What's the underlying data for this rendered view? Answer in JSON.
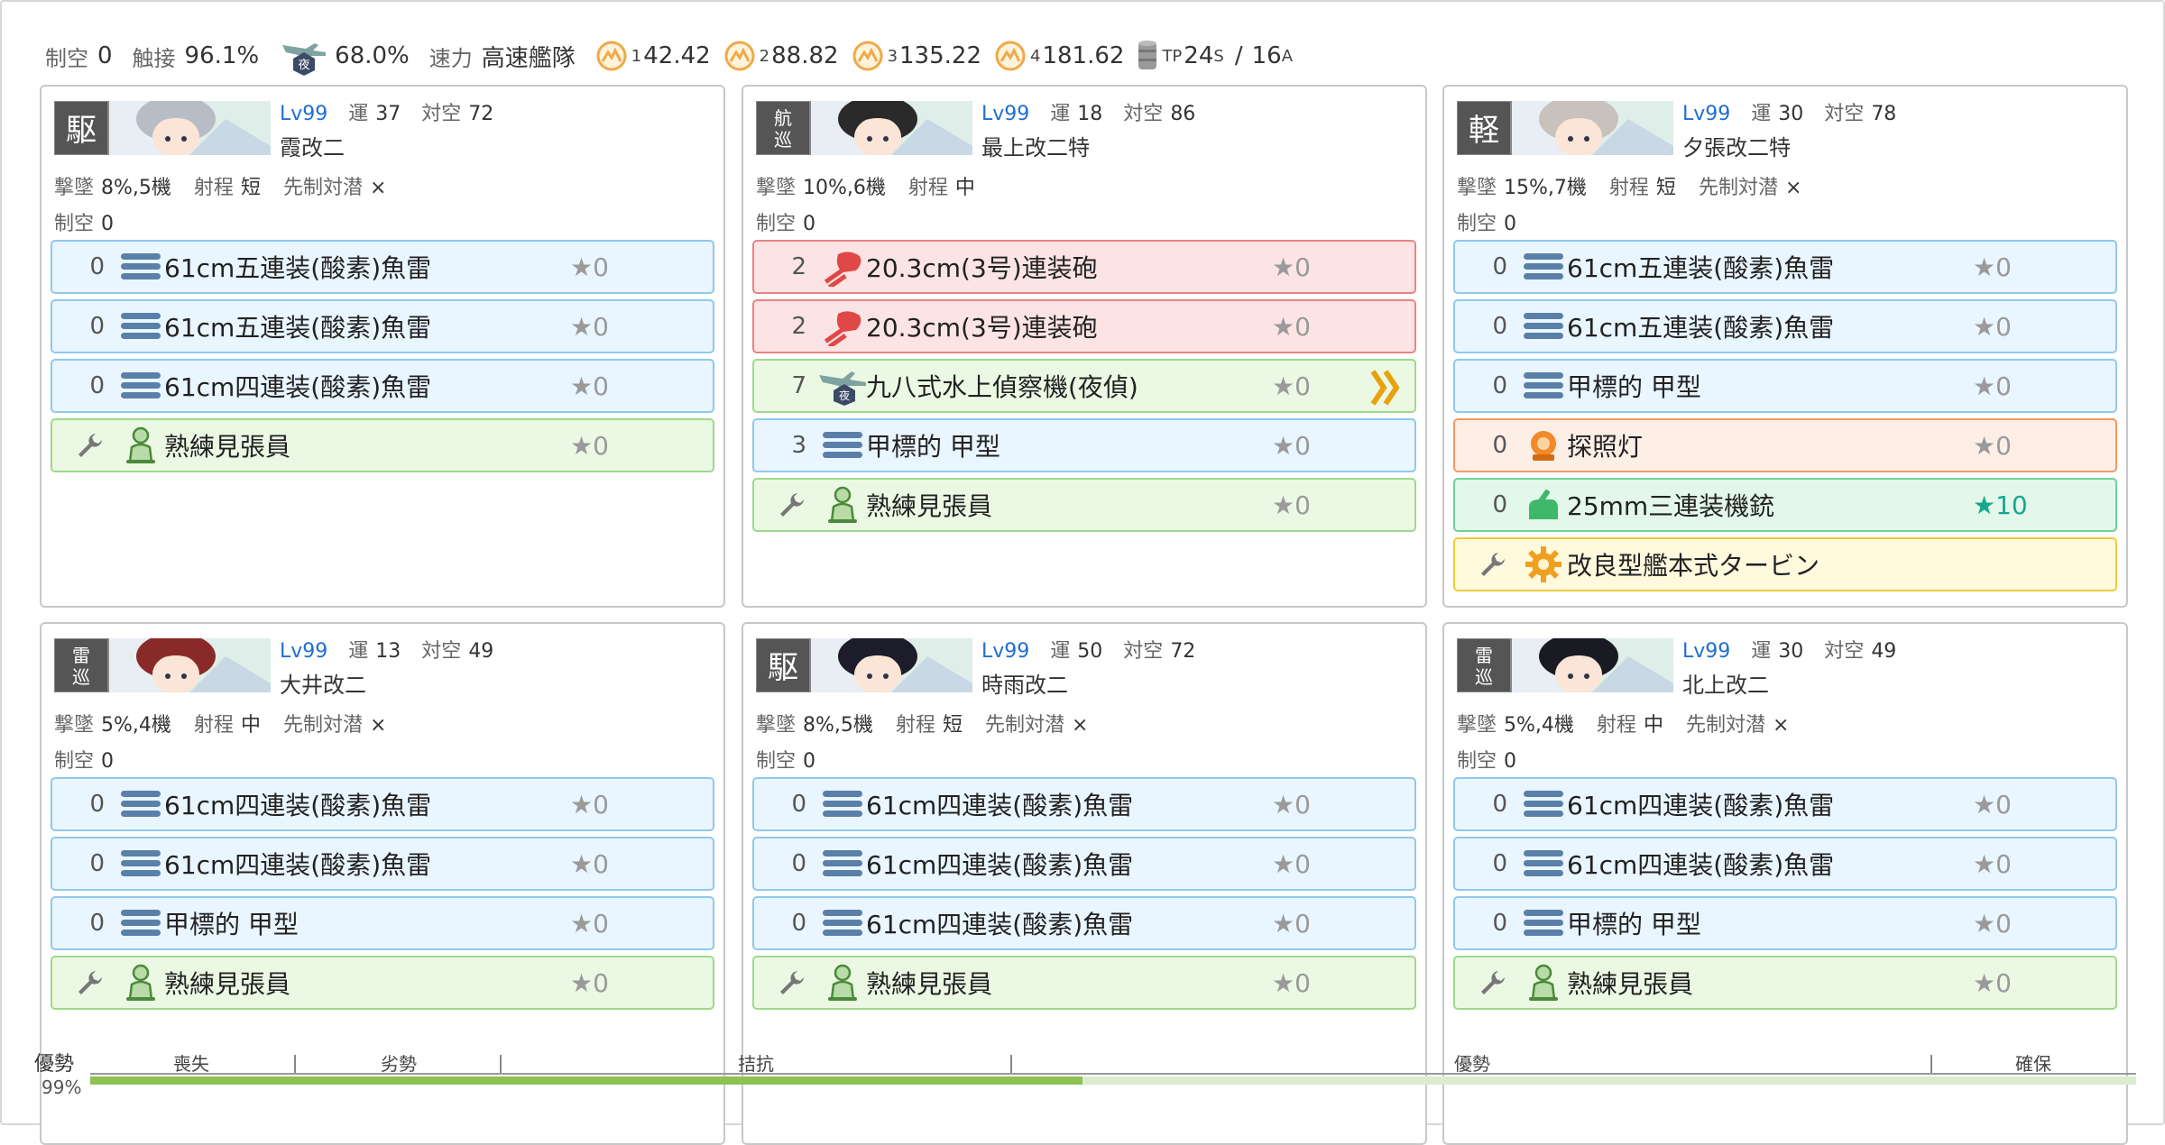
{
  "fleet": {
    "air_label": "制空",
    "air_value": "0",
    "contact_label": "触接",
    "contact_value": "96.1%",
    "night_contact_value": "68.0%",
    "speed_label": "速力",
    "speed_value": "高速艦隊",
    "los": [
      {
        "sub": "1",
        "value": "42.42"
      },
      {
        "sub": "2",
        "value": "88.82"
      },
      {
        "sub": "3",
        "value": "135.22"
      },
      {
        "sub": "4",
        "value": "181.62"
      }
    ],
    "tp_label": "TP",
    "tp_s": "24",
    "tp_s_sub": "S",
    "tp_sep": "/",
    "tp_a": "16",
    "tp_a_sub": "A"
  },
  "labels": {
    "luck": "運",
    "aa": "対空",
    "shootdown": "撃墜",
    "range": "射程",
    "asw": "先制対潜",
    "air": "制空"
  },
  "ships": [
    {
      "lv": "Lv99",
      "luck": "37",
      "aa": "72",
      "name": "霞改二",
      "type_kanji": "駆",
      "shootdown": "8%,5機",
      "range": "短",
      "asw": "×",
      "air": "0",
      "slots": [
        {
          "count": "0",
          "icon": "torpedo-icon",
          "name": "61cm五連装(酸素)魚雷",
          "star": "★0",
          "tone": "blue"
        },
        {
          "count": "0",
          "icon": "torpedo-icon",
          "name": "61cm五連装(酸素)魚雷",
          "star": "★0",
          "tone": "blue"
        },
        {
          "count": "0",
          "icon": "torpedo-icon",
          "name": "61cm四連装(酸素)魚雷",
          "star": "★0",
          "tone": "blue"
        },
        {
          "count": "",
          "icon": "lookout-icon",
          "name": "熟練見張員",
          "star": "★0",
          "tone": "green",
          "ex": true
        }
      ]
    },
    {
      "lv": "Lv99",
      "luck": "18",
      "aa": "86",
      "name": "最上改二特",
      "type_kanji": "航巡",
      "shootdown": "10%,6機",
      "range": "中",
      "asw": "",
      "air": "0",
      "slots": [
        {
          "count": "2",
          "icon": "main-gun-icon",
          "name": "20.3cm(3号)連装砲",
          "star": "★0",
          "tone": "red"
        },
        {
          "count": "2",
          "icon": "main-gun-icon",
          "name": "20.3cm(3号)連装砲",
          "star": "★0",
          "tone": "red"
        },
        {
          "count": "7",
          "icon": "night-seaplane-icon",
          "name": "九八式水上偵察機(夜偵)",
          "star": "★0",
          "tone": "green",
          "prof": true
        },
        {
          "count": "3",
          "icon": "torpedo-icon",
          "name": "甲標的 甲型",
          "star": "★0",
          "tone": "blue"
        },
        {
          "count": "",
          "icon": "lookout-icon",
          "name": "熟練見張員",
          "star": "★0",
          "tone": "green",
          "ex": true
        }
      ]
    },
    {
      "lv": "Lv99",
      "luck": "30",
      "aa": "78",
      "name": "夕張改二特",
      "type_kanji": "軽",
      "shootdown": "15%,7機",
      "range": "短",
      "asw": "×",
      "air": "0",
      "slots": [
        {
          "count": "0",
          "icon": "torpedo-icon",
          "name": "61cm五連装(酸素)魚雷",
          "star": "★0",
          "tone": "blue"
        },
        {
          "count": "0",
          "icon": "torpedo-icon",
          "name": "61cm五連装(酸素)魚雷",
          "star": "★0",
          "tone": "blue"
        },
        {
          "count": "0",
          "icon": "torpedo-icon",
          "name": "甲標的 甲型",
          "star": "★0",
          "tone": "blue"
        },
        {
          "count": "0",
          "icon": "searchlight-icon",
          "name": "探照灯",
          "star": "★0",
          "tone": "orange"
        },
        {
          "count": "0",
          "icon": "aa-gun-icon",
          "name": "25mm三連装機銃",
          "star": "★10",
          "tone": "teal",
          "max": true
        },
        {
          "count": "",
          "icon": "turbine-icon",
          "name": "改良型艦本式タービン",
          "star": "",
          "tone": "yellow",
          "ex": true
        }
      ]
    },
    {
      "lv": "Lv99",
      "luck": "13",
      "aa": "49",
      "name": "大井改二",
      "type_kanji": "雷巡",
      "shootdown": "5%,4機",
      "range": "中",
      "asw": "×",
      "air": "0",
      "slots": [
        {
          "count": "0",
          "icon": "torpedo-icon",
          "name": "61cm四連装(酸素)魚雷",
          "star": "★0",
          "tone": "blue"
        },
        {
          "count": "0",
          "icon": "torpedo-icon",
          "name": "61cm四連装(酸素)魚雷",
          "star": "★0",
          "tone": "blue"
        },
        {
          "count": "0",
          "icon": "torpedo-icon",
          "name": "甲標的 甲型",
          "star": "★0",
          "tone": "blue"
        },
        {
          "count": "",
          "icon": "lookout-icon",
          "name": "熟練見張員",
          "star": "★0",
          "tone": "green",
          "ex": true
        }
      ]
    },
    {
      "lv": "Lv99",
      "luck": "50",
      "aa": "72",
      "name": "時雨改二",
      "type_kanji": "駆",
      "shootdown": "8%,5機",
      "range": "短",
      "asw": "×",
      "air": "0",
      "slots": [
        {
          "count": "0",
          "icon": "torpedo-icon",
          "name": "61cm四連装(酸素)魚雷",
          "star": "★0",
          "tone": "blue"
        },
        {
          "count": "0",
          "icon": "torpedo-icon",
          "name": "61cm四連装(酸素)魚雷",
          "star": "★0",
          "tone": "blue"
        },
        {
          "count": "0",
          "icon": "torpedo-icon",
          "name": "61cm四連装(酸素)魚雷",
          "star": "★0",
          "tone": "blue"
        },
        {
          "count": "",
          "icon": "lookout-icon",
          "name": "熟練見張員",
          "star": "★0",
          "tone": "green",
          "ex": true
        }
      ]
    },
    {
      "lv": "Lv99",
      "luck": "30",
      "aa": "49",
      "name": "北上改二",
      "type_kanji": "雷巡",
      "shootdown": "5%,4機",
      "range": "中",
      "asw": "×",
      "air": "0",
      "slots": [
        {
          "count": "0",
          "icon": "torpedo-icon",
          "name": "61cm四連装(酸素)魚雷",
          "star": "★0",
          "tone": "blue"
        },
        {
          "count": "0",
          "icon": "torpedo-icon",
          "name": "61cm四連装(酸素)魚雷",
          "star": "★0",
          "tone": "blue"
        },
        {
          "count": "0",
          "icon": "torpedo-icon",
          "name": "甲標的 甲型",
          "star": "★0",
          "tone": "blue"
        },
        {
          "count": "",
          "icon": "lookout-icon",
          "name": "熟練見張員",
          "star": "★0",
          "tone": "green",
          "ex": true
        }
      ]
    }
  ],
  "air_state": {
    "label": "優勢",
    "percent": "99%",
    "fill_fraction": 0.485,
    "zones": [
      "喪失",
      "劣勢",
      "拮抗",
      "優勢",
      "確保"
    ]
  },
  "colors": {
    "blue_bg": "#e9f6ff",
    "red_bg": "#fde4e4",
    "green_bg": "#ebf9e4",
    "orange_bg": "#fdeee6",
    "teal_bg": "#e3f7ea",
    "yellow_bg": "#fff9de",
    "level_blue": "#1f6fd0",
    "star_max": "#14a88c",
    "air_fill": "#8dc252"
  }
}
